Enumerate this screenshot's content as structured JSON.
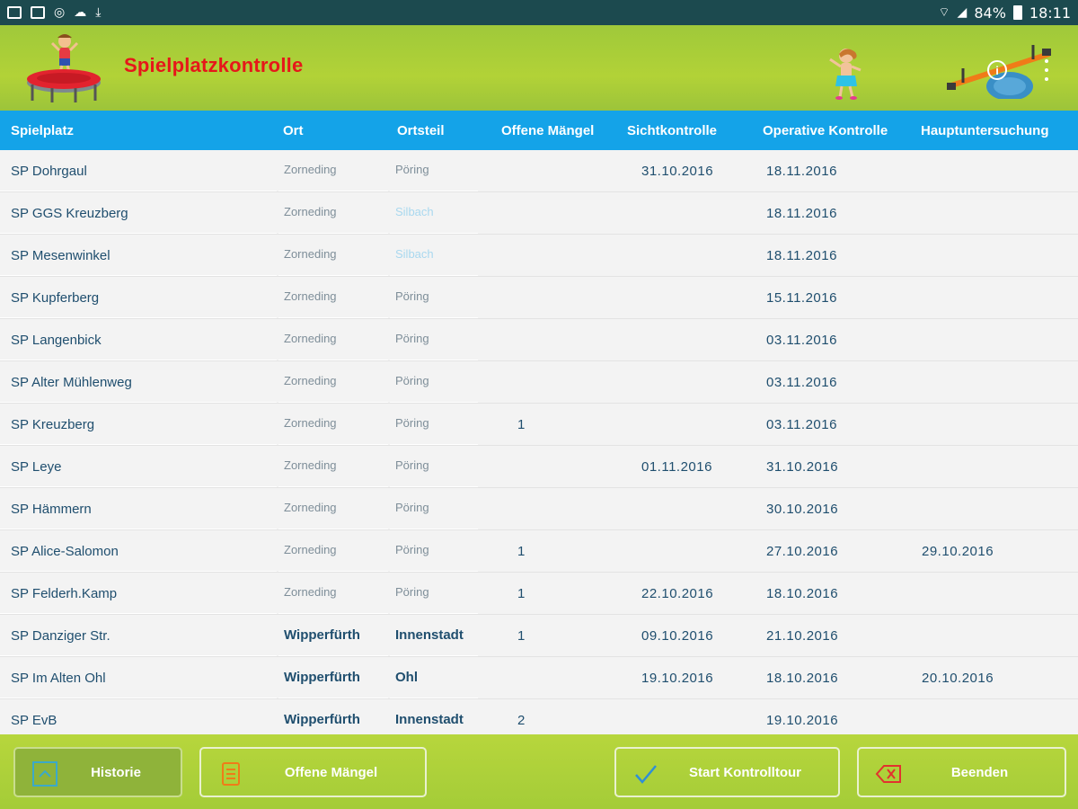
{
  "status_bar": {
    "left_icons": [
      "photo-icon",
      "save-icon",
      "globe-icon",
      "cloud-icon",
      "download-icon"
    ],
    "battery": "84%",
    "time": "18:11"
  },
  "header": {
    "title": "Spielplatzkontrolle",
    "colors": {
      "header_green": "#a8cd3a",
      "title_red": "#e6171a",
      "table_header_blue": "#14a3e8"
    }
  },
  "table": {
    "columns": [
      "Spielplatz",
      "Ort",
      "Ortsteil",
      "Offene Mängel",
      "Sichtkontrolle",
      "Operative Kontrolle",
      "Hauptuntersuchung"
    ],
    "rows": [
      {
        "spielplatz": "SP Dohrgaul",
        "ort": "Zorneding",
        "ortsteil": "Pöring",
        "maengel": "",
        "sicht": "31.10.2016",
        "operativ": "18.11.2016",
        "haupt": ""
      },
      {
        "spielplatz": "SP GGS Kreuzberg",
        "ort": "Zorneding",
        "ortsteil": "Silbach",
        "maengel": "",
        "sicht": "",
        "operativ": "18.11.2016",
        "haupt": ""
      },
      {
        "spielplatz": "SP Mesenwinkel",
        "ort": "Zorneding",
        "ortsteil": "Silbach",
        "maengel": "",
        "sicht": "",
        "operativ": "18.11.2016",
        "haupt": ""
      },
      {
        "spielplatz": "SP Kupferberg",
        "ort": "Zorneding",
        "ortsteil": "Pöring",
        "maengel": "",
        "sicht": "",
        "operativ": "15.11.2016",
        "haupt": ""
      },
      {
        "spielplatz": "SP Langenbick",
        "ort": "Zorneding",
        "ortsteil": "Pöring",
        "maengel": "",
        "sicht": "",
        "operativ": "03.11.2016",
        "haupt": ""
      },
      {
        "spielplatz": "SP Alter Mühlenweg",
        "ort": "Zorneding",
        "ortsteil": "Pöring",
        "maengel": "",
        "sicht": "",
        "operativ": "03.11.2016",
        "haupt": ""
      },
      {
        "spielplatz": "SP Kreuzberg",
        "ort": "Zorneding",
        "ortsteil": "Pöring",
        "maengel": "1",
        "sicht": "",
        "operativ": "03.11.2016",
        "haupt": ""
      },
      {
        "spielplatz": "SP Leye",
        "ort": "Zorneding",
        "ortsteil": "Pöring",
        "maengel": "",
        "sicht": "01.11.2016",
        "operativ": "31.10.2016",
        "haupt": ""
      },
      {
        "spielplatz": "SP Hämmern",
        "ort": "Zorneding",
        "ortsteil": "Pöring",
        "maengel": "",
        "sicht": "",
        "operativ": "30.10.2016",
        "haupt": ""
      },
      {
        "spielplatz": "SP Alice-Salomon",
        "ort": "Zorneding",
        "ortsteil": "Pöring",
        "maengel": "1",
        "sicht": "",
        "operativ": "27.10.2016",
        "haupt": "29.10.2016"
      },
      {
        "spielplatz": "SP Felderh.Kamp",
        "ort": "Zorneding",
        "ortsteil": "Pöring",
        "maengel": "1",
        "sicht": "22.10.2016",
        "operativ": "18.10.2016",
        "haupt": ""
      },
      {
        "spielplatz": "SP Danziger Str.",
        "ort": "Wipperfürth",
        "ortsteil": "Innenstadt",
        "maengel": "1",
        "sicht": "09.10.2016",
        "operativ": "21.10.2016",
        "haupt": ""
      },
      {
        "spielplatz": "SP Im Alten Ohl",
        "ort": "Wipperfürth",
        "ortsteil": "Ohl",
        "maengel": "",
        "sicht": "19.10.2016",
        "operativ": "18.10.2016",
        "haupt": "20.10.2016"
      },
      {
        "spielplatz": "SP EvB",
        "ort": "Wipperfürth",
        "ortsteil": "Innenstadt",
        "maengel": "2",
        "sicht": "",
        "operativ": "19.10.2016",
        "haupt": ""
      }
    ]
  },
  "footer": {
    "buttons": [
      {
        "label": "Historie",
        "icon": "chevron-up-icon"
      },
      {
        "label": "Offene Mängel",
        "icon": "clipboard-icon"
      },
      {
        "label": "Start Kontrolltour",
        "icon": "checkmark-icon"
      },
      {
        "label": "Beenden",
        "icon": "backspace-icon"
      }
    ]
  }
}
